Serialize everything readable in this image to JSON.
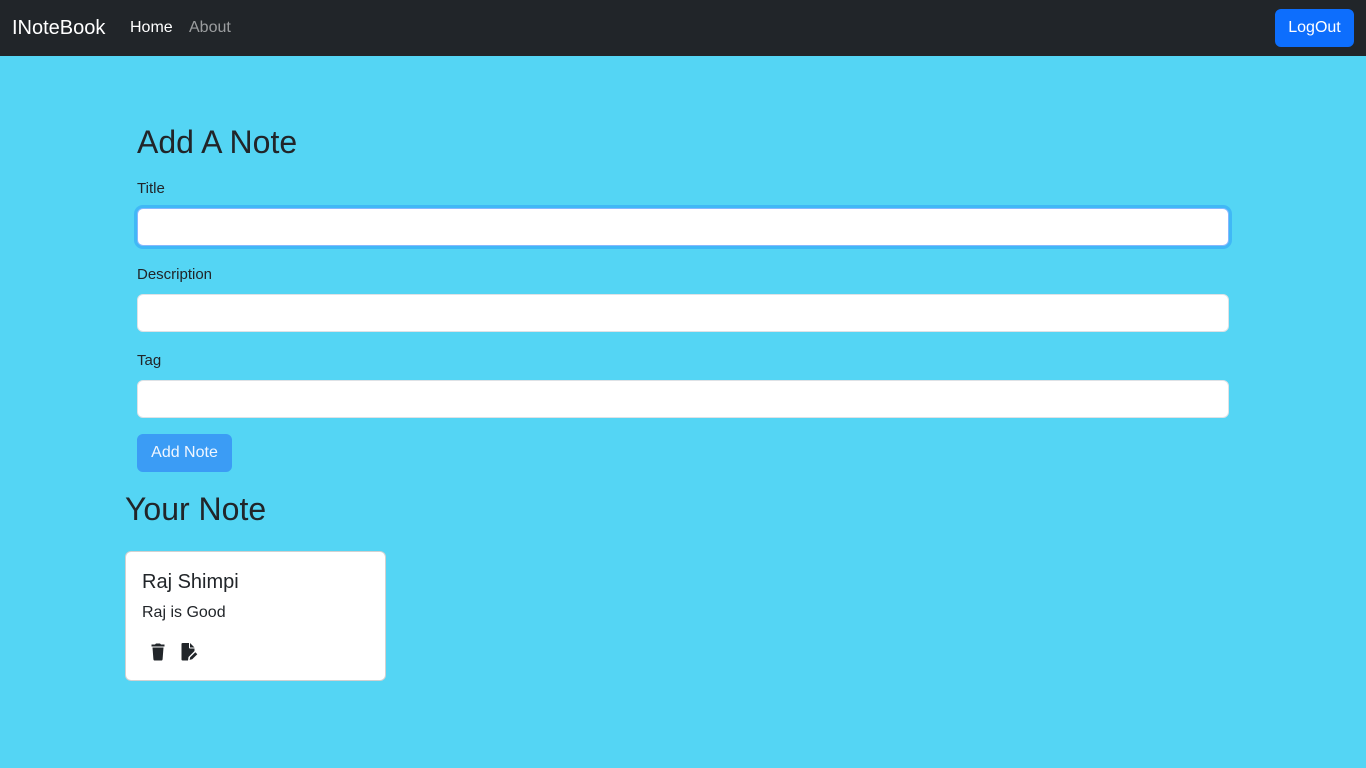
{
  "navbar": {
    "brand": "INoteBook",
    "links": [
      {
        "label": "Home",
        "active": true
      },
      {
        "label": "About",
        "active": false
      }
    ],
    "logout_label": "LogOut"
  },
  "add_note_form": {
    "heading": "Add A Note",
    "title_label": "Title",
    "title_value": "",
    "description_label": "Description",
    "description_value": "",
    "tag_label": "Tag",
    "tag_value": "",
    "submit_label": "Add Note"
  },
  "notes_section": {
    "heading": "Your Note",
    "notes": [
      {
        "title": "Raj Shimpi",
        "description": "Raj is Good",
        "actions": [
          "trash-icon",
          "edit-document-icon"
        ]
      }
    ]
  },
  "colors": {
    "page_background": "#54d5f4",
    "navbar_background": "#212529",
    "logout_button": "#0d6efd",
    "add_note_button": "#3b9cf5"
  }
}
